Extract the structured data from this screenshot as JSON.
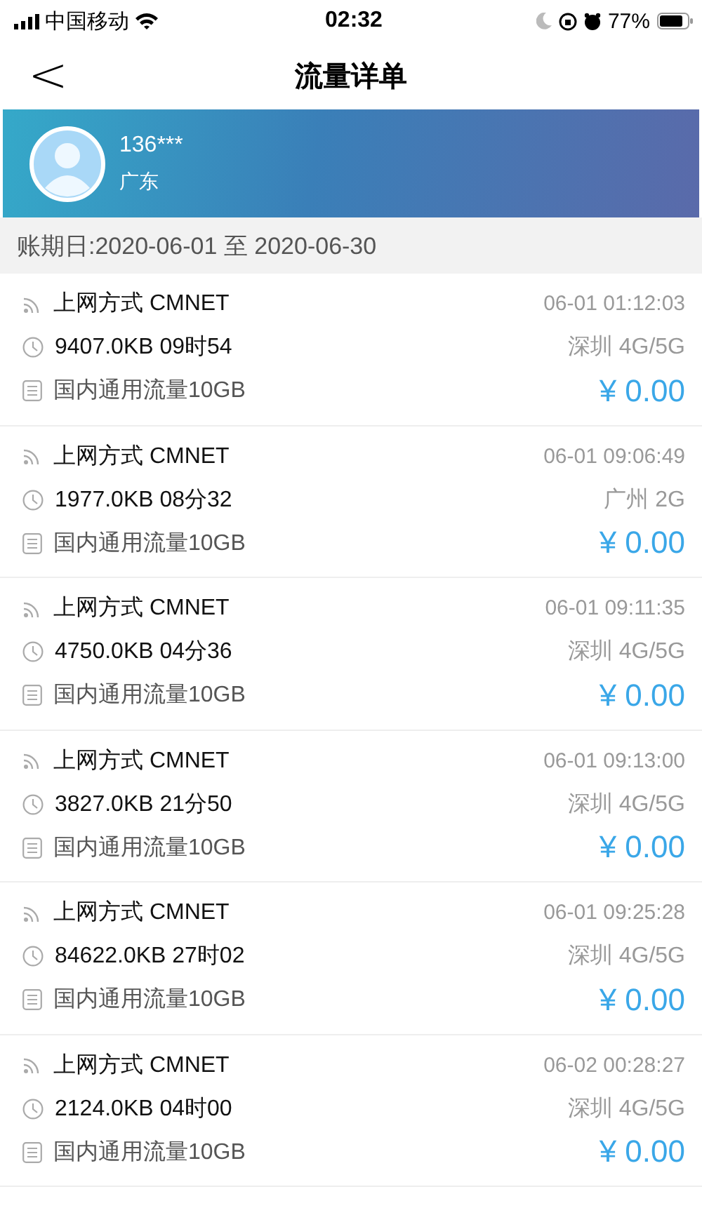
{
  "status_bar": {
    "carrier": "中国移动",
    "time": "02:32",
    "battery": "77%"
  },
  "nav": {
    "back": "<",
    "title": "流量详单"
  },
  "account": {
    "phone": "136***",
    "region": "广东"
  },
  "period": "账期日:2020-06-01 至 2020-06-30",
  "records": [
    {
      "method": "上网方式 CMNET",
      "usage": "9407.0KB 09时54",
      "package": "国内通用流量10GB",
      "time": "06-01 01:12:03",
      "place": "深圳 4G/5G",
      "fee": "¥ 0.00"
    },
    {
      "method": "上网方式 CMNET",
      "usage": "1977.0KB 08分32",
      "package": "国内通用流量10GB",
      "time": "06-01 09:06:49",
      "place": "广州 2G",
      "fee": "¥ 0.00"
    },
    {
      "method": "上网方式 CMNET",
      "usage": "4750.0KB 04分36",
      "package": "国内通用流量10GB",
      "time": "06-01 09:11:35",
      "place": "深圳 4G/5G",
      "fee": "¥ 0.00"
    },
    {
      "method": "上网方式 CMNET",
      "usage": "3827.0KB 21分50",
      "package": "国内通用流量10GB",
      "time": "06-01 09:13:00",
      "place": "深圳 4G/5G",
      "fee": "¥ 0.00"
    },
    {
      "method": "上网方式 CMNET",
      "usage": "84622.0KB 27时02",
      "package": "国内通用流量10GB",
      "time": "06-01 09:25:28",
      "place": "深圳 4G/5G",
      "fee": "¥ 0.00"
    },
    {
      "method": "上网方式 CMNET",
      "usage": "2124.0KB 04时00",
      "package": "国内通用流量10GB",
      "time": "06-02 00:28:27",
      "place": "深圳 4G/5G",
      "fee": "¥ 0.00"
    }
  ]
}
